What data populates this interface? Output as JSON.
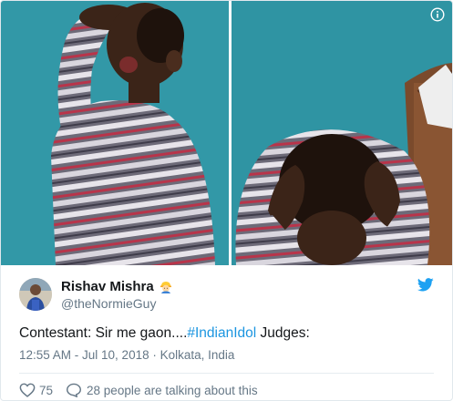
{
  "tweet": {
    "display_name": "Rishav Mishra",
    "handle": "@theNormieGuy",
    "text_before": "Contestant: Sir me gaon....",
    "hashtag": "#IndianIdol",
    "text_after": " Judges:",
    "timestamp": "12:55 AM - Jul 10, 2018",
    "separator": "·",
    "location": "Kolkata, India",
    "likes": "75",
    "conversation": "28 people are talking about this"
  },
  "icons": {
    "info": "info-icon",
    "verified_emoji": "construction-worker-emoji-icon",
    "brand": "twitter-bird-icon",
    "like": "heart-icon",
    "reply": "speech-bubble-icon"
  },
  "colors": {
    "brand_blue": "#1da1f2",
    "hashtag_blue": "#1b95e0",
    "meta_gray": "#657786",
    "text_dark": "#14171a",
    "wall_teal": "#2f94a3"
  }
}
